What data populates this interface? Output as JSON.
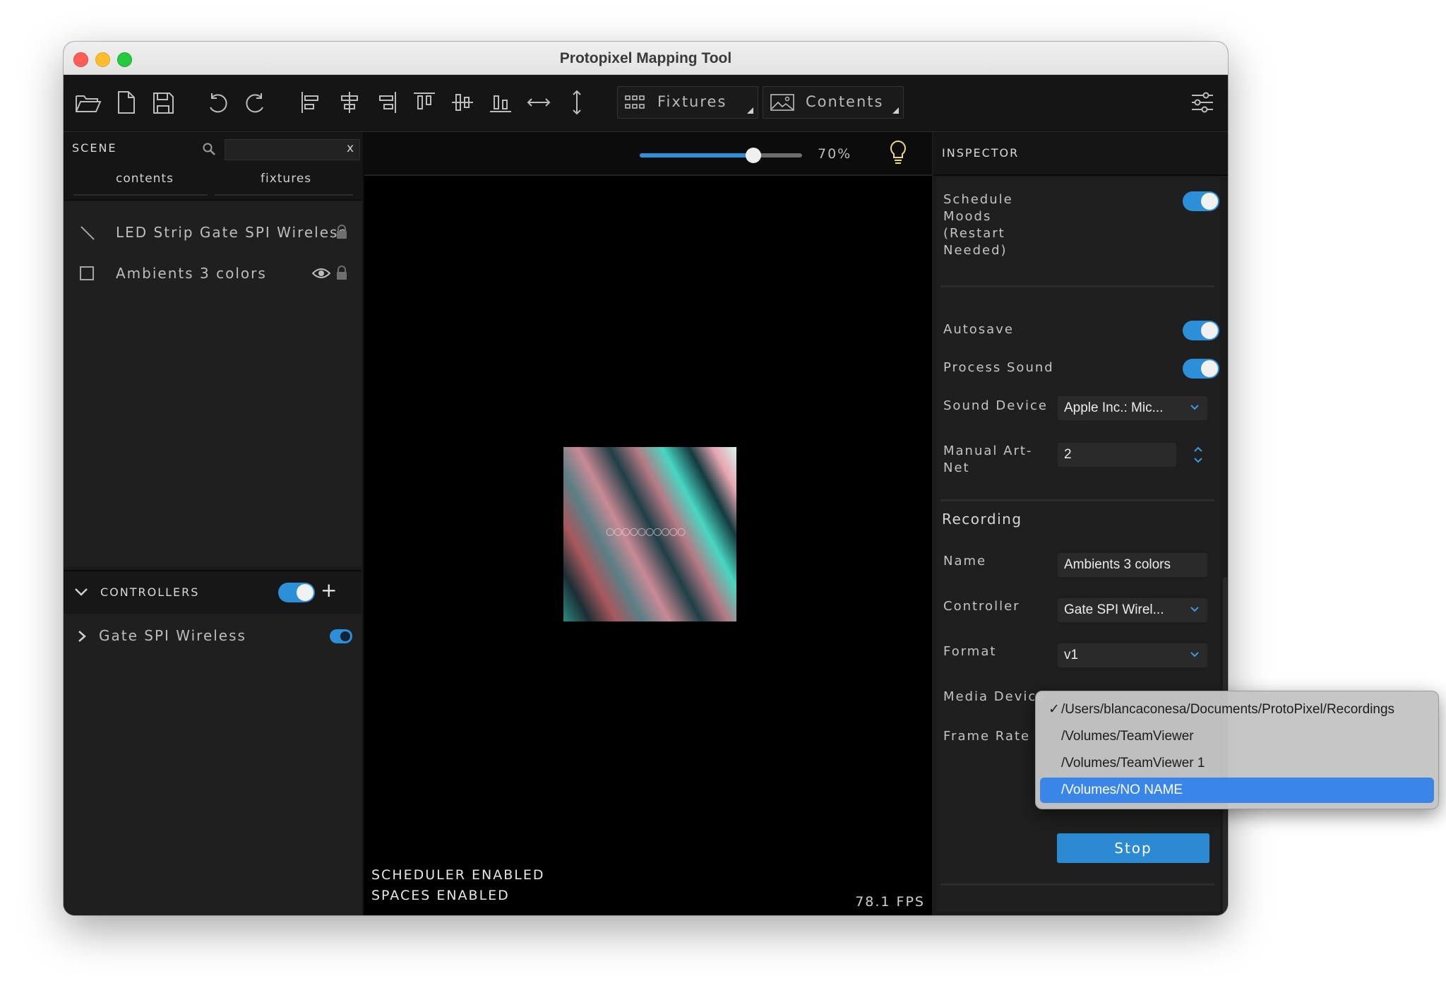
{
  "window": {
    "title": "Protopixel Mapping Tool"
  },
  "toolbar": {
    "fixtures_label": "Fixtures",
    "contents_label": "Contents"
  },
  "scene": {
    "title": "SCENE",
    "search_close": "x",
    "tabs": [
      "contents",
      "fixtures"
    ],
    "items": [
      {
        "label": "LED Strip Gate SPI Wireless"
      },
      {
        "label": "Ambients 3 colors"
      }
    ]
  },
  "controllers": {
    "title": "CONTROLLERS",
    "add": "+",
    "items": [
      {
        "label": "Gate SPI Wireless"
      }
    ]
  },
  "viewport": {
    "zoom": "70%",
    "zoom_value": 0.7,
    "status": [
      "SCHEDULER ENABLED",
      "SPACES ENABLED"
    ],
    "fps": "78.1 FPS"
  },
  "inspector": {
    "title": "INSPECTOR",
    "schedule_moods": "Schedule Moods (Restart Needed)",
    "autosave": "Autosave",
    "process_sound": "Process Sound",
    "sound_device_label": "Sound Device",
    "sound_device_value": "Apple Inc.: Mic...",
    "manual_artnet_label": "Manual Art-Net",
    "manual_artnet_value": "2",
    "recording_title": "Recording",
    "name_label": "Name",
    "name_value": "Ambients 3 colors",
    "controller_label": "Controller",
    "controller_value": "Gate SPI Wirel...",
    "format_label": "Format",
    "format_value": "v1",
    "media_device_label": "Media Device",
    "frame_rate_label": "Frame Rate",
    "stop_label": "Stop"
  },
  "media_menu": {
    "check": "✓",
    "options": [
      "/Users/blancaconesa/Documents/ProtoPixel/Recordings",
      "/Volumes/TeamViewer",
      "/Volumes/TeamViewer 1",
      "/Volumes/NO NAME"
    ]
  },
  "colors": {
    "accent": "#2d8fd8",
    "menu_highlight": "#3a86e8"
  }
}
